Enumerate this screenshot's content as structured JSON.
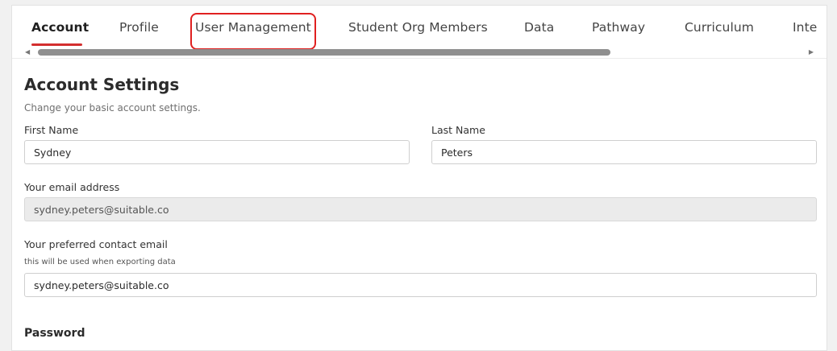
{
  "tabs": [
    {
      "label": "Account",
      "active": true
    },
    {
      "label": "Profile"
    },
    {
      "label": "User Management",
      "highlighted": true
    },
    {
      "label": "Student Org Members"
    },
    {
      "label": "Data"
    },
    {
      "label": "Pathway"
    },
    {
      "label": "Curriculum"
    },
    {
      "label": "Inte"
    }
  ],
  "colors": {
    "accent": "#d32f2f",
    "highlight": "#e02020"
  },
  "account": {
    "title": "Account Settings",
    "subtitle": "Change your basic account settings.",
    "first_name": {
      "label": "First Name",
      "value": "Sydney"
    },
    "last_name": {
      "label": "Last Name",
      "value": "Peters"
    },
    "email": {
      "label": "Your email address",
      "value": "sydney.peters@suitable.co"
    },
    "contact_email": {
      "label": "Your preferred contact email",
      "hint": "this will be used when exporting data",
      "value": "sydney.peters@suitable.co"
    }
  },
  "password": {
    "title": "Password"
  }
}
